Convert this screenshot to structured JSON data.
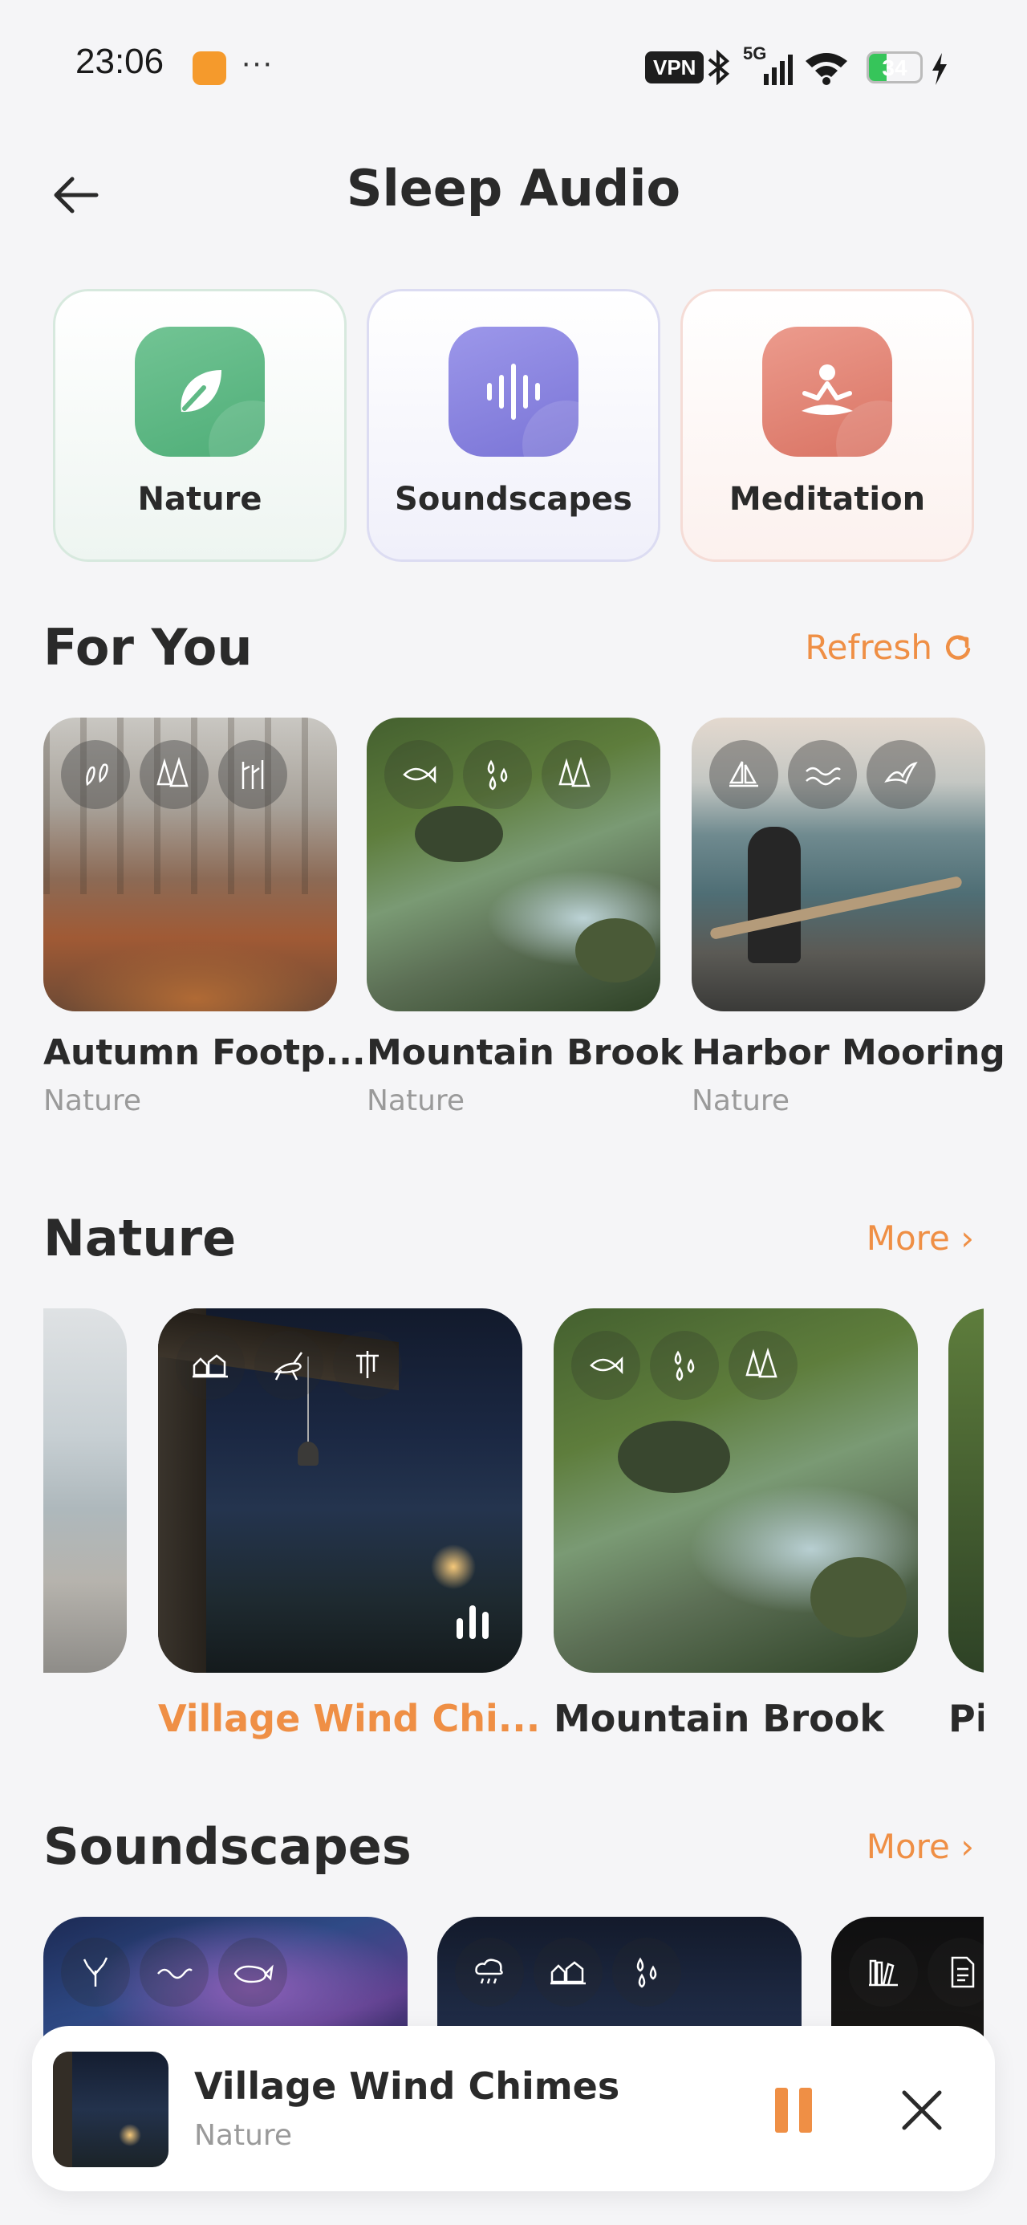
{
  "status_bar": {
    "time": "23:06",
    "dots": "···",
    "vpn": "VPN",
    "network": "5G",
    "battery": "34",
    "battery_level": 0.34,
    "colors": {
      "app_icon": "#f59a2c",
      "battery": "#36c55a"
    }
  },
  "header": {
    "title": "Sleep Audio",
    "back_icon": "arrow-left-icon"
  },
  "categories": [
    {
      "label": "Nature",
      "icon": "leaf-icon",
      "color": "#5fb985"
    },
    {
      "label": "Soundscapes",
      "icon": "waveform-icon",
      "color": "#8b86e2"
    },
    {
      "label": "Meditation",
      "icon": "meditation-icon",
      "color": "#e2826f"
    }
  ],
  "for_you": {
    "title": "For You",
    "action": "Refresh",
    "action_icon": "refresh-icon",
    "items": [
      {
        "title": "Autumn Footp...",
        "category": "Nature",
        "tags": [
          "footprint-icon",
          "forest-icon",
          "woods-icon"
        ]
      },
      {
        "title": "Mountain Brook",
        "category": "Nature",
        "tags": [
          "fish-icon",
          "raindrops-icon",
          "forest-icon"
        ]
      },
      {
        "title": "Harbor Mooring",
        "category": "Nature",
        "tags": [
          "sailboat-icon",
          "waves-icon",
          "seagull-icon"
        ]
      }
    ]
  },
  "nature": {
    "title": "Nature",
    "action": "More ›",
    "items": [
      {
        "title": "Village Wind Chi...",
        "active": true,
        "tags": [
          "village-icon",
          "cricket-icon",
          "wind-chime-icon"
        ]
      },
      {
        "title": "Mountain Brook",
        "active": false,
        "tags": [
          "fish-icon",
          "raindrops-icon",
          "forest-icon"
        ]
      },
      {
        "title": "Pi",
        "active": false
      }
    ]
  },
  "soundscapes": {
    "title": "Soundscapes",
    "action": "More ›",
    "items": [
      {
        "tags": [
          "coral-icon",
          "wave-icon",
          "whale-icon"
        ]
      },
      {
        "tags": [
          "rain-cloud-icon",
          "village-icon",
          "raindrops-icon"
        ]
      },
      {
        "tags": [
          "books-icon",
          "document-icon"
        ]
      }
    ]
  },
  "player": {
    "title": "Village Wind Chimes",
    "category": "Nature",
    "accent": "#ef8f45"
  }
}
